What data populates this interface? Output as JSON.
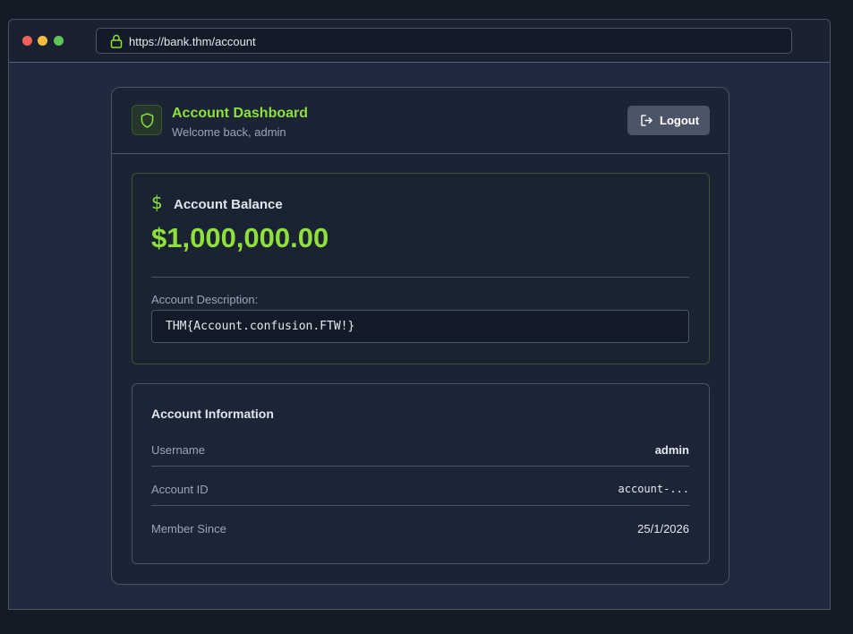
{
  "browser": {
    "url": "https://bank.thm/account",
    "window_controls": [
      "close",
      "minimize",
      "maximize"
    ]
  },
  "header": {
    "title": "Account Dashboard",
    "subtitle": "Welcome back, admin",
    "icon": "shield-icon",
    "logout_label": "Logout"
  },
  "balance": {
    "label": "Account Balance",
    "currency_icon": "$",
    "value": "$1,000,000.00",
    "description_label": "Account Description:",
    "description_value": "THM{Account.confusion.FTW!}"
  },
  "info": {
    "title": "Account Information",
    "rows": [
      {
        "label": "Username",
        "value": "admin"
      },
      {
        "label": "Account ID",
        "value": "account-..."
      },
      {
        "label": "Member Since",
        "value": "25/1/2026"
      }
    ]
  },
  "colors": {
    "accent": "#8fe03a",
    "background": "#1f2a3e",
    "card": "#1b2435",
    "button": "#4c5567"
  }
}
